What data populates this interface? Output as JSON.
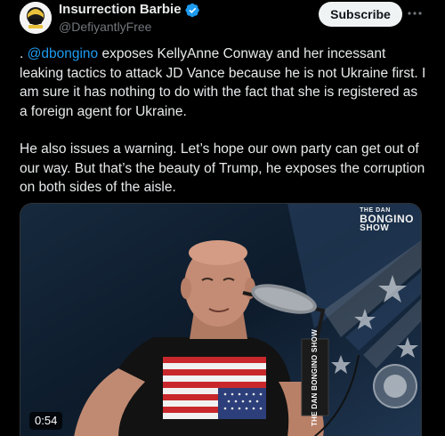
{
  "post": {
    "author": {
      "display_name": "Insurrection Barbie",
      "handle": "@DefiyantlyFree",
      "verified": true,
      "avatar_icon": "avatar-image"
    },
    "subscribe_label": "Subscribe",
    "more_icon": "more-horizontal-icon",
    "text": {
      "prefix": ". ",
      "mention": "@dbongino",
      "para1_rest": " exposes KellyAnne Conway and her incessant leaking tactics to attack JD Vance because he is not Ukraine first. I am sure it has nothing to do with the fact that she is registered as a foreign agent for Ukraine.",
      "para2": "He also issues a warning. Let’s hope our own party can get out of our way. But that’s the beauty of Trump, he exposes the corruption on both sides of the aisle."
    },
    "media": {
      "duration": "0:54",
      "logo": {
        "line1": "THE DAN",
        "line2": "BONGINO",
        "line3": "SHOW"
      },
      "mic_box_text": "THE DAN BONGINO SHOW"
    }
  },
  "colors": {
    "background": "#000000",
    "text": "#e7e9ea",
    "secondary_text": "#71767b",
    "link": "#1d9bf0",
    "verified_badge": "#1d9bf0",
    "subscribe_bg": "#eff3f4"
  }
}
